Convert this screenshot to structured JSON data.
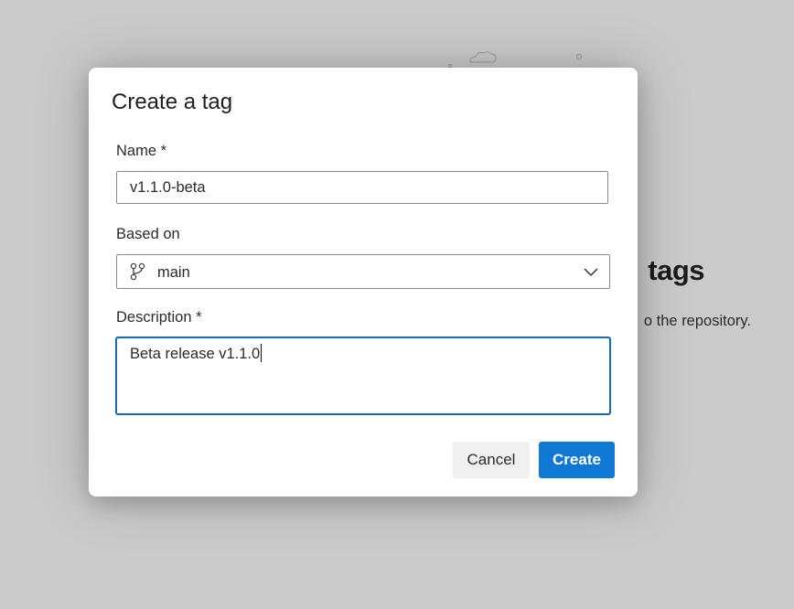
{
  "background": {
    "heading": "tags",
    "subtext": "o the repository."
  },
  "dialog": {
    "title": "Create a tag",
    "name_label": "Name *",
    "name_value": "v1.1.0-beta",
    "based_on_label": "Based on",
    "based_on_value": "main",
    "description_label": "Description *",
    "description_value": "Beta release v1.1.0",
    "cancel_label": "Cancel",
    "create_label": "Create"
  },
  "colors": {
    "primary": "#0f78d4",
    "focus_border": "#0f6cbd"
  },
  "icons": {
    "branch": "branch-icon",
    "chevron": "chevron-down-icon"
  }
}
